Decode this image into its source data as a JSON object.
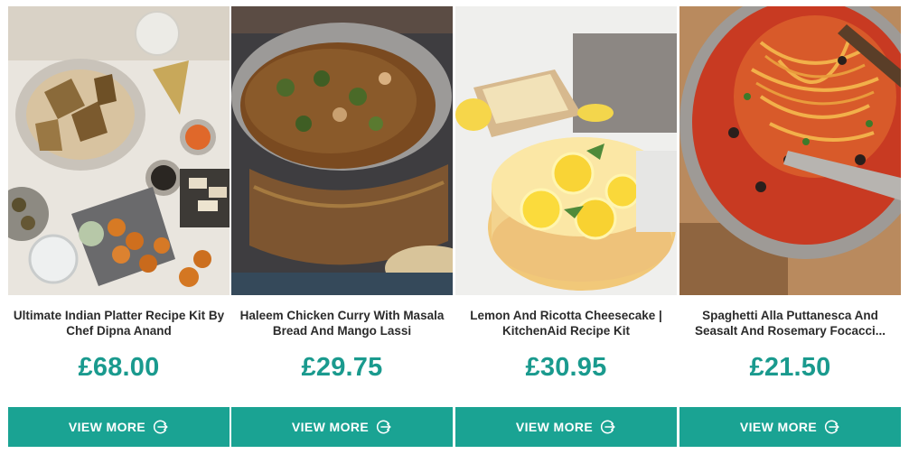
{
  "colors": {
    "accent": "#1aa393",
    "price": "#1a9a8e",
    "title": "#2b2b2b"
  },
  "products": [
    {
      "image": "indian-platter-photo",
      "title": "Ultimate Indian Platter Recipe Kit By Chef Dipna Anand",
      "price": "£68.00",
      "button": "VIEW MORE",
      "button_icon": "arrow-right-circle-icon"
    },
    {
      "image": "haleem-curry-photo",
      "title": "Haleem Chicken Curry With Masala Bread And Mango Lassi",
      "price": "£29.75",
      "button": "VIEW MORE",
      "button_icon": "arrow-right-circle-icon"
    },
    {
      "image": "lemon-cheesecake-photo",
      "title": "Lemon And Ricotta Cheesecake | KitchenAid Recipe Kit",
      "price": "£30.95",
      "button": "VIEW MORE",
      "button_icon": "arrow-right-circle-icon"
    },
    {
      "image": "spaghetti-puttanesca-photo",
      "title": "Spaghetti Alla Puttanesca And Seasalt And Rosemary Focacci...",
      "price": "£21.50",
      "button": "VIEW MORE",
      "button_icon": "arrow-right-circle-icon"
    }
  ]
}
